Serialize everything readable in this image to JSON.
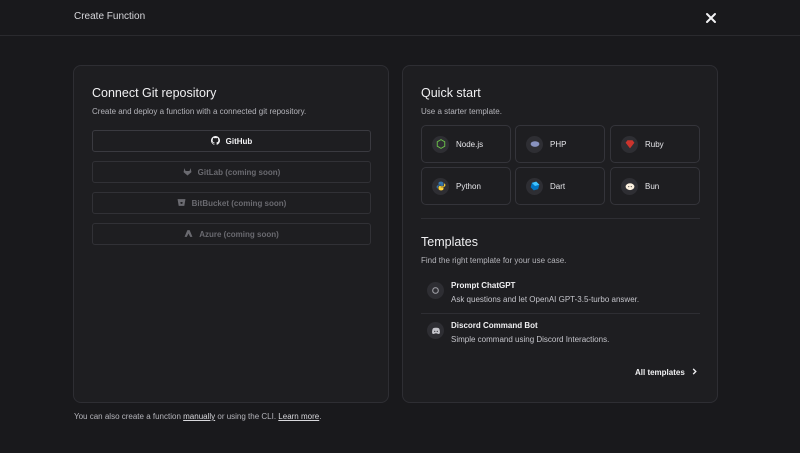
{
  "header": {
    "title": "Create Function"
  },
  "git": {
    "heading": "Connect Git repository",
    "description": "Create and deploy a function with a connected git repository.",
    "providers": [
      {
        "label": "GitHub",
        "icon": "github-icon"
      },
      {
        "label": "GitLab (coming soon)",
        "icon": "gitlab-icon"
      },
      {
        "label": "BitBucket (coming soon)",
        "icon": "bitbucket-icon"
      },
      {
        "label": "Azure (coming soon)",
        "icon": "azure-icon"
      }
    ]
  },
  "quickstart": {
    "heading": "Quick start",
    "description": "Use a starter template.",
    "runtimes": [
      {
        "label": "Node.js",
        "icon": "nodejs-icon",
        "color": "#6cc24a"
      },
      {
        "label": "PHP",
        "icon": "php-icon",
        "color": "#8892bf"
      },
      {
        "label": "Ruby",
        "icon": "ruby-icon",
        "color": "#cc342d"
      },
      {
        "label": "Python",
        "icon": "python-icon",
        "color": "#3776ab"
      },
      {
        "label": "Dart",
        "icon": "dart-icon",
        "color": "#0175c2"
      },
      {
        "label": "Bun",
        "icon": "bun-icon",
        "color": "#fbf0df"
      }
    ]
  },
  "templates": {
    "heading": "Templates",
    "description": "Find the right template for your use case.",
    "items": [
      {
        "name": "Prompt ChatGPT",
        "desc": "Ask questions and let OpenAI GPT-3.5-turbo answer.",
        "icon": "openai-icon"
      },
      {
        "name": "Discord Command Bot",
        "desc": "Simple command using Discord Interactions.",
        "icon": "discord-icon"
      }
    ],
    "all_label": "All templates"
  },
  "footer": {
    "prefix": "You can also create a function ",
    "manual_link": "manually",
    "middle": " or using the CLI. ",
    "learn_link": "Learn more",
    "suffix": "."
  }
}
